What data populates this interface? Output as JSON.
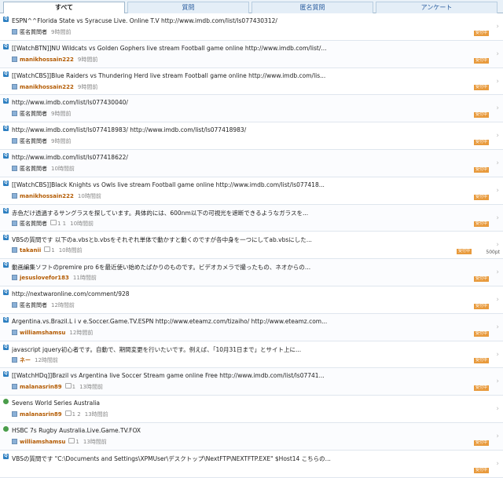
{
  "tabs": [
    {
      "label": "すべて"
    },
    {
      "label": "質問"
    },
    {
      "label": "匿名質問"
    },
    {
      "label": "アンケート"
    }
  ],
  "rows": [
    {
      "title": "ESPN^^Florida State vs Syracuse Live. Online T.V http://www.imdb.com/list/ls077430312/",
      "user": "匿名質問者",
      "time": "9時間前",
      "counts": "",
      "badge": "受付中",
      "points": ""
    },
    {
      "title": "[[WatchBTN]]NU Wildcats vs Golden Gophers live stream Football game online http://www.imdb.com/list/...",
      "user": "manikhossain222",
      "time": "9時間前",
      "counts": "",
      "badge": "受付中",
      "points": ""
    },
    {
      "title": "[[WatchCBS]]Blue Raiders vs Thundering Herd live stream Football game online http://www.imdb.com/lis...",
      "user": "manikhossain222",
      "time": "9時間前",
      "counts": "",
      "badge": "受付中",
      "points": ""
    },
    {
      "title": "http://www.imdb.com/list/ls077430040/",
      "user": "匿名質問者",
      "time": "9時間前",
      "counts": "",
      "badge": "受付中",
      "points": ""
    },
    {
      "title": "http://www.imdb.com/list/ls077418983/ http://www.imdb.com/list/ls077418983/",
      "user": "匿名質問者",
      "time": "9時間前",
      "counts": "",
      "badge": "受付中",
      "points": ""
    },
    {
      "title": "http://www.imdb.com/list/ls077418622/",
      "user": "匿名質問者",
      "time": "10時間前",
      "counts": "",
      "badge": "受付中",
      "points": ""
    },
    {
      "title": "[[WatchCBS]]Black Knights vs Owls live stream Football game online http://www.imdb.com/list/ls077418...",
      "user": "manikhossain222",
      "time": "10時間前",
      "counts": "",
      "badge": "受付中",
      "points": ""
    },
    {
      "title": "赤色だけ透過するサングラスを探しています。具体的には、600nm以下の可視光を遮断できるようなガラスを...",
      "user": "匿名質問者",
      "time": "10時間前",
      "counts": "1 1",
      "badge": "受付中",
      "points": ""
    },
    {
      "title": "VBSの質問です 以下のa.vbsとb.vbsをそれぞれ単体で動かすと動くのですが各中身を一つにしてab.vbsにした...",
      "user": "takanii",
      "time": "10時間前",
      "counts": "1",
      "badge": "受付中",
      "points": "500pt"
    },
    {
      "title": "動画編集ソフトのpremire pro 6を最近使い始めたばかりのものです。ビデオカメラで撮ったもの、ネオからの...",
      "user": "jesuslovefor183",
      "time": "11時間前",
      "counts": "",
      "badge": "受付中",
      "points": ""
    },
    {
      "title": "http://nextwaronline.com/comment/928",
      "user": "匿名質問者",
      "time": "12時間前",
      "counts": "",
      "badge": "受付中",
      "points": ""
    },
    {
      "title": "Argentina.vs.Brazil.L i v e.Soccer.Game.TV.ESPN http://www.eteamz.com/tizaiho/ http://www.eteamz.com...",
      "user": "williamshamsu",
      "time": "12時間前",
      "counts": "",
      "badge": "受付中",
      "points": ""
    },
    {
      "title": "javascript jquery初心者です。自動で、期間変更を行いたいです。例えば、「10月31日まで」とサイト上に...",
      "user": "ネー",
      "time": "12時間前",
      "counts": "",
      "badge": "受付中",
      "points": ""
    },
    {
      "title": "[[WatchHDq]]Brazil vs Argentina live Soccer Stream game online Free http://www.imdb.com/list/ls07741...",
      "user": "malanasrin89",
      "time": "13時間前",
      "counts": "1",
      "badge": "受付中",
      "points": ""
    },
    {
      "title": "Sevens World Series Australia",
      "user": "malanasrin89",
      "time": "13時間前",
      "counts": "1 2",
      "badge": "",
      "points": ""
    },
    {
      "title": "HSBC 7s Rugby Australia.Live.Game.TV.FOX",
      "user": "williamshamsu",
      "time": "13時間前",
      "counts": "1",
      "badge": "受付中",
      "points": ""
    },
    {
      "title": "VBSの質問です \"C:\\Documents and Settings\\XPMUser\\デスクトップ\\NextFTP\\NEXTFTP.EXE\" $Host14 こちらの...",
      "user": "",
      "time": "",
      "counts": "",
      "badge": "受付中",
      "points": ""
    }
  ]
}
